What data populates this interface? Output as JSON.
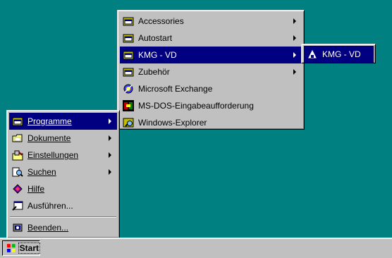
{
  "start_menu": {
    "items": [
      {
        "label": "Programme",
        "icon": "programs-folder-icon",
        "submenu": true
      },
      {
        "label": "Dokumente",
        "icon": "documents-folder-icon",
        "submenu": true
      },
      {
        "label": "Einstellungen",
        "icon": "settings-icon",
        "submenu": true
      },
      {
        "label": "Suchen",
        "icon": "find-icon",
        "submenu": true
      },
      {
        "label": "Hilfe",
        "icon": "help-book-icon",
        "submenu": false
      },
      {
        "label": "Ausführen...",
        "icon": "run-icon",
        "submenu": false
      },
      {
        "label": "Beenden...",
        "icon": "shutdown-icon",
        "submenu": false
      }
    ]
  },
  "programs_menu": {
    "items": [
      {
        "label": "Accessories",
        "icon": "program-group-icon",
        "submenu": true
      },
      {
        "label": "Autostart",
        "icon": "program-group-icon",
        "submenu": true
      },
      {
        "label": "KMG - VD",
        "icon": "program-group-icon",
        "submenu": true
      },
      {
        "label": "Zubehör",
        "icon": "program-group-icon",
        "submenu": true
      },
      {
        "label": "Microsoft Exchange",
        "icon": "exchange-icon",
        "submenu": false
      },
      {
        "label": "MS-DOS-Eingabeaufforderung",
        "icon": "msdos-icon",
        "submenu": false
      },
      {
        "label": "Windows-Explorer",
        "icon": "explorer-icon",
        "submenu": false
      }
    ]
  },
  "kmg_menu": {
    "items": [
      {
        "label": "KMG - VD",
        "icon": "kmg-app-icon"
      }
    ]
  },
  "taskbar": {
    "start_label": "Start"
  },
  "colors": {
    "desktop": "#008080",
    "menu_face": "#c0c0c0",
    "highlight": "#000080",
    "highlight_text": "#ffffff"
  }
}
